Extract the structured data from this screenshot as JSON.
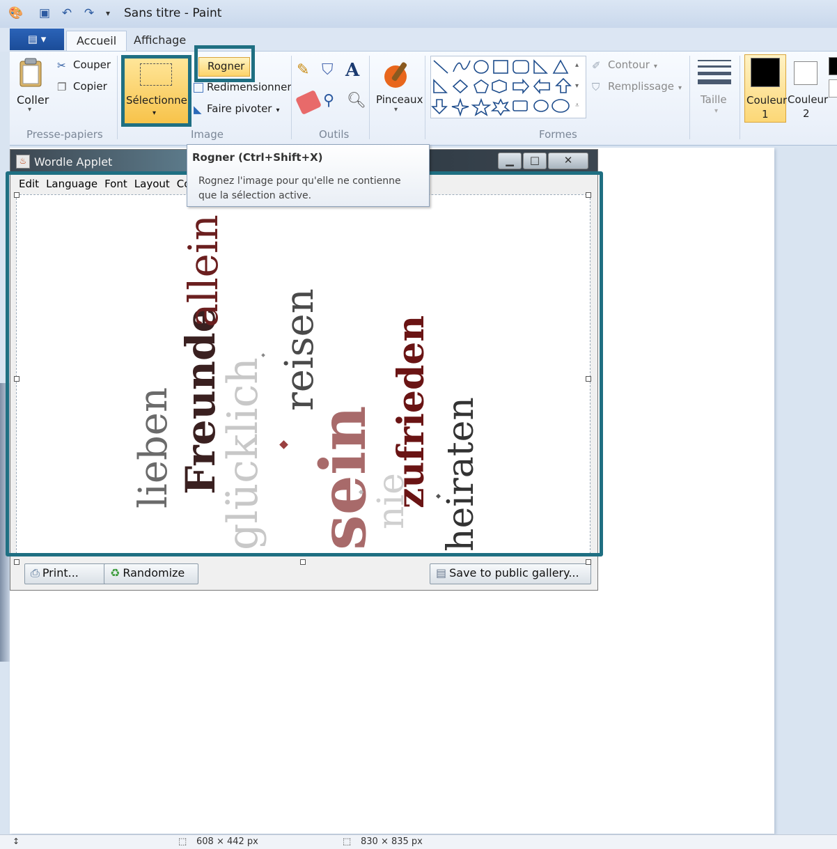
{
  "window": {
    "title": "Sans titre - Paint"
  },
  "tabs": {
    "file_menu": "▤ ▾",
    "accueil": "Accueil",
    "affichage": "Affichage"
  },
  "clipboard": {
    "coller": "Coller",
    "couper": "Couper",
    "copier": "Copier",
    "label": "Presse-papiers"
  },
  "image": {
    "selectionner": "Sélectionner",
    "rogner": "Rogner",
    "redimensionner": "Redimensionner",
    "faire_pivoter": "Faire pivoter",
    "label": "Image"
  },
  "tools": {
    "label": "Outils"
  },
  "brushes": {
    "label": "Pinceaux"
  },
  "shapes": {
    "contour": "Contour",
    "remplissage": "Remplissage",
    "label": "Formes"
  },
  "size": {
    "label": "Taille"
  },
  "colors": {
    "couleur1_line1": "Couleur",
    "couleur1_line2": "1",
    "couleur2_line1": "Couleur",
    "couleur2_line2": "2",
    "color1_value": "#000000",
    "color2_value": "#ffffff",
    "accent": "#1f6f82"
  },
  "tooltip": {
    "title": "Rogner (Ctrl+Shift+X)",
    "description": "Rognez l'image pour qu'elle ne contienne que la sélection active."
  },
  "applet": {
    "title": "Wordle Applet",
    "menu": [
      "Edit",
      "Language",
      "Font",
      "Layout",
      "Colo"
    ],
    "buttons": {
      "print": "Print...",
      "randomize": "Randomize",
      "save": "Save to public gallery..."
    },
    "words": [
      {
        "text": "lieben",
        "color": "#6b6b6b"
      },
      {
        "text": "Freunde",
        "color": "#3a2020"
      },
      {
        "text": "allein",
        "color": "#6b1f1f"
      },
      {
        "text": "glücklich",
        "color": "#c8c8c8"
      },
      {
        "text": "reisen",
        "color": "#4a4a4a"
      },
      {
        "text": "sein",
        "color": "#a86a6a"
      },
      {
        "text": "nie",
        "color": "#d0d0d0"
      },
      {
        "text": "zufrieden",
        "color": "#6a1414"
      },
      {
        "text": "heiraten",
        "color": "#333333"
      }
    ]
  },
  "status": {
    "selection_size": "608 × 442 px",
    "image_size": "830 × 835 px"
  }
}
